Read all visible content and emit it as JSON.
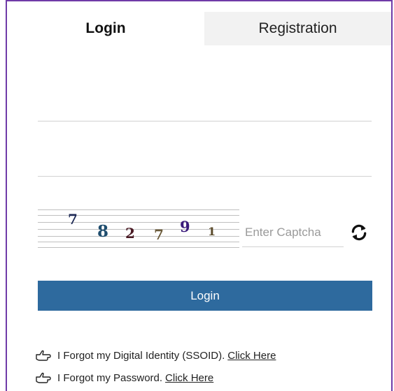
{
  "tabs": {
    "login": "Login",
    "registration": "Registration"
  },
  "form": {
    "username_value": "",
    "password_value": "",
    "captcha_placeholder": "Enter Captcha"
  },
  "captcha": {
    "digits": [
      {
        "char": "7",
        "color": "#1e2a55"
      },
      {
        "char": "8",
        "color": "#1f4d6e"
      },
      {
        "char": "2",
        "color": "#4a1a24"
      },
      {
        "char": "7",
        "color": "#6b5a3a"
      },
      {
        "char": "9",
        "color": "#3a1a7a"
      },
      {
        "char": "1",
        "color": "#5a4a2a"
      }
    ]
  },
  "login_button": "Login",
  "help": {
    "forgot_ssoid_text": "I Forgot my Digital Identity (SSOID).",
    "forgot_ssoid_link": "Click Here",
    "forgot_password_text": "I Forgot my Password.",
    "forgot_password_link": "Click Here"
  },
  "colors": {
    "border": "#6f3aa8",
    "button": "#2e6a9e",
    "tab_inactive": "#f2f2f2"
  },
  "icons": {
    "refresh": "refresh-icon",
    "hand": "pointing-hand-icon"
  }
}
